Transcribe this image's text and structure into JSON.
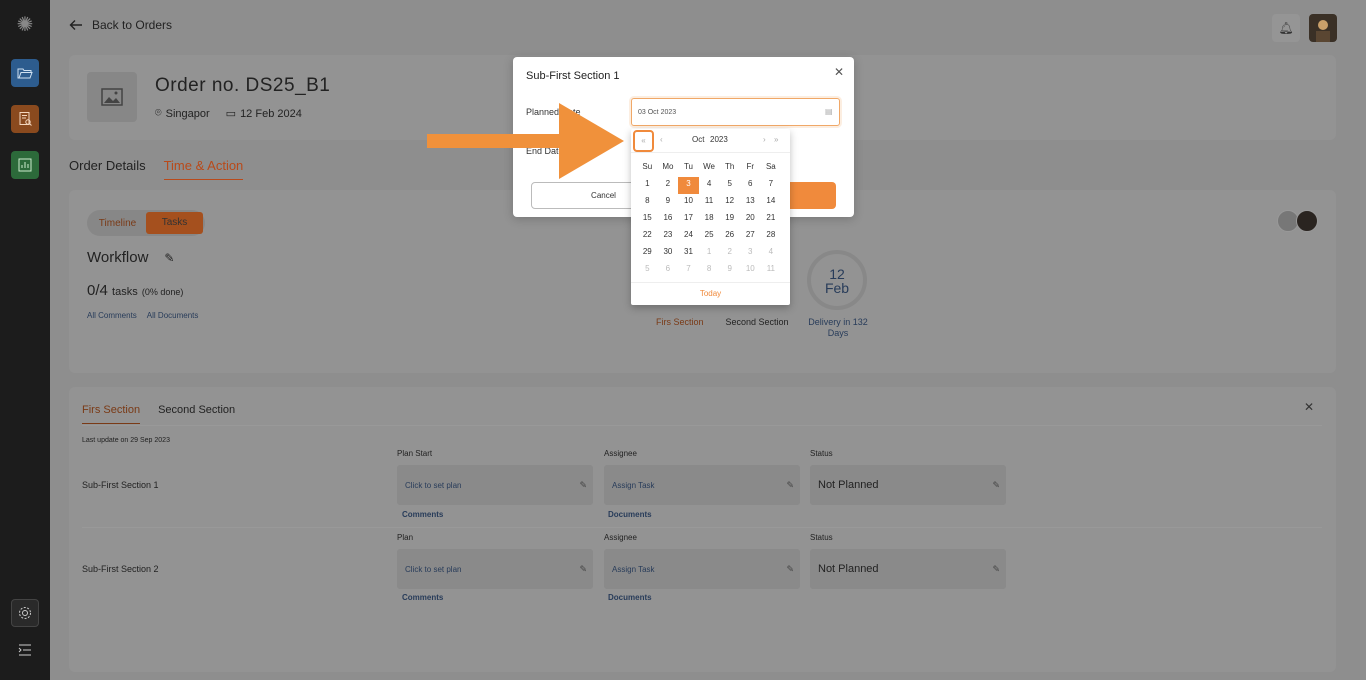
{
  "topbar": {
    "back_label": "Back to Orders"
  },
  "order": {
    "title": "Order no. DS25_B1",
    "location": "Singapor",
    "date": "12 Feb 2024"
  },
  "main_tabs": {
    "details": "Order Details",
    "time_action": "Time & Action"
  },
  "workflow": {
    "toggle_timeline": "Timeline",
    "toggle_tasks": "Tasks",
    "title": "Workflow",
    "tasks_count": "0/4",
    "tasks_label": "tasks",
    "tasks_done": "(0% done)",
    "all_comments": "All Comments",
    "all_documents": "All Documents",
    "delivery_day": "12",
    "delivery_month": "Feb",
    "delivery_text": "Delivery in 132 Days",
    "section_first": "Firs Section",
    "section_second": "Second Section"
  },
  "sections": {
    "tab_first": "Firs Section",
    "tab_second": "Second Section",
    "last_update": "Last update on 29 Sep 2023",
    "rows": [
      {
        "title": "Sub-First Section 1",
        "plan_label": "Plan Start",
        "plan_value": "Click to set plan",
        "assignee_label": "Assignee",
        "assignee_value": "Assign Task",
        "status_label": "Status",
        "status_value": "Not Planned",
        "comments": "Comments",
        "documents": "Documents"
      },
      {
        "title": "Sub-First Section 2",
        "plan_label": "Plan",
        "plan_value": "Click to set plan",
        "assignee_label": "Assignee",
        "assignee_value": "Assign Task",
        "status_label": "Status",
        "status_value": "Not Planned",
        "comments": "Comments",
        "documents": "Documents"
      }
    ]
  },
  "modal": {
    "title": "Sub-First Section 1",
    "planned_date_label": "Planned Date",
    "planned_date_value": "03 Oct 2023",
    "end_date_label": "End Date",
    "cancel": "Cancel"
  },
  "calendar": {
    "prev_year": "«",
    "prev_month": "‹",
    "month": "Oct",
    "year": "2023",
    "next_month": "›",
    "next_year": "»",
    "weekdays": [
      "Su",
      "Mo",
      "Tu",
      "We",
      "Th",
      "Fr",
      "Sa"
    ],
    "weeks": [
      [
        "1",
        "2",
        "3",
        "4",
        "5",
        "6",
        "7"
      ],
      [
        "8",
        "9",
        "10",
        "11",
        "12",
        "13",
        "14"
      ],
      [
        "15",
        "16",
        "17",
        "18",
        "19",
        "20",
        "21"
      ],
      [
        "22",
        "23",
        "24",
        "25",
        "26",
        "27",
        "28"
      ],
      [
        "29",
        "30",
        "31",
        "1",
        "2",
        "3",
        "4"
      ],
      [
        "5",
        "6",
        "7",
        "8",
        "9",
        "10",
        "11"
      ]
    ],
    "selected": "3",
    "today": "Today"
  },
  "colors": {
    "accent": "#f08a3c",
    "sidebar_active": "#2d5c8e",
    "annotation_arrow": "#f0913b"
  }
}
